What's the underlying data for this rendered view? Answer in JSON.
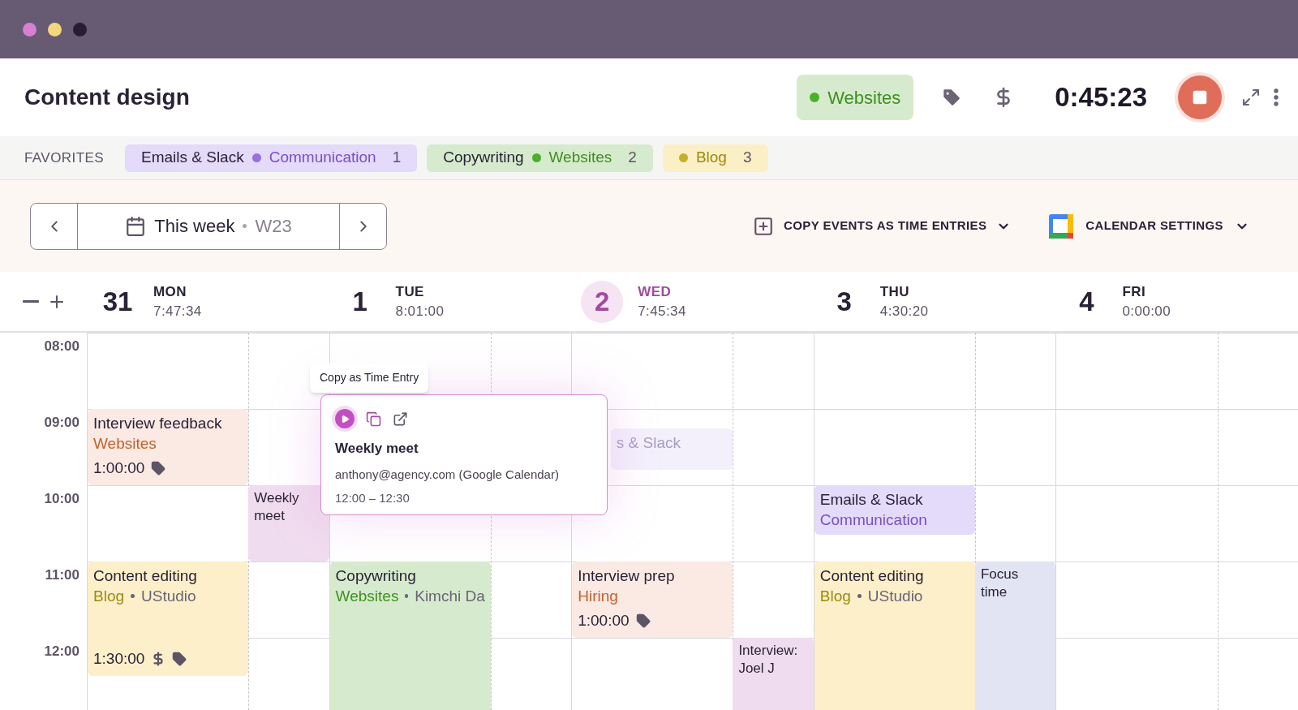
{
  "window": {
    "title": "Content design"
  },
  "current": {
    "project": "Websites",
    "color": "#4caf2a",
    "timer": "0:45:23",
    "running": true
  },
  "favorites": {
    "label": "FAVORITES",
    "items": [
      {
        "task": "Emails & Slack",
        "project": "Communication",
        "count": "1",
        "kind": "purple"
      },
      {
        "task": "Copywriting",
        "project": "Websites",
        "count": "2",
        "kind": "green"
      },
      {
        "project": "Blog",
        "count": "3",
        "kind": "yellow"
      }
    ]
  },
  "toolbar": {
    "range": "This week",
    "week": "W23",
    "copy_events": "COPY EVENTS AS TIME ENTRIES",
    "settings": "CALENDAR SETTINGS"
  },
  "hours": [
    "08:00",
    "09:00",
    "10:00",
    "11:00",
    "12:00"
  ],
  "days": [
    {
      "number": "31",
      "name": "MON",
      "total": "7:47:34",
      "selected": false,
      "events": [
        {
          "title": "Interview feedback",
          "project": "Websites",
          "duration": "1:00:00",
          "tag": true,
          "kind": "peach"
        },
        {
          "title": "Weekly meet",
          "kind": "pink"
        },
        {
          "title": "Content editing",
          "project": "Blog",
          "client": "UStudio",
          "duration": "1:30:00",
          "tag": true,
          "billable": true,
          "kind": "yellow"
        }
      ]
    },
    {
      "number": "1",
      "name": "TUE",
      "total": "8:01:00",
      "selected": false,
      "events": [
        {
          "title": "Copywriting",
          "project": "Websites",
          "client": "Kimchi Da",
          "kind": "green"
        }
      ]
    },
    {
      "number": "2",
      "name": "WED",
      "total": "7:45:34",
      "selected": true,
      "events": [
        {
          "title": "s & Slack",
          "kind": "faded"
        },
        {
          "title": "Interview prep",
          "project": "Hiring",
          "duration": "1:00:00",
          "tag": true,
          "kind": "peach"
        },
        {
          "title": "Interview: Joel J",
          "kind": "pink"
        }
      ]
    },
    {
      "number": "3",
      "name": "THU",
      "total": "4:30:20",
      "selected": false,
      "events": [
        {
          "title": "Emails & Slack",
          "project": "Communication",
          "kind": "purple"
        },
        {
          "title": "Content editing",
          "project": "Blog",
          "client": "UStudio",
          "kind": "yellow"
        },
        {
          "title": "Focus time",
          "kind": "lavender"
        }
      ]
    },
    {
      "number": "4",
      "name": "FRI",
      "total": "0:00:00",
      "selected": false
    }
  ],
  "popup": {
    "tooltip": "Copy as Time Entry",
    "title": "Weekly meet",
    "calendar": "anthony@agency.com (Google Calendar)",
    "time": "12:00 – 12:30"
  }
}
